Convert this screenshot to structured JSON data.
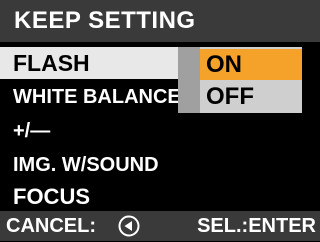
{
  "header": {
    "title": "KEEP SETTING"
  },
  "menu": {
    "items": [
      {
        "label": "FLASH",
        "selected": true
      },
      {
        "label": "WHITE BALANCE",
        "selected": false
      },
      {
        "label": "+/—",
        "selected": false
      },
      {
        "label": "IMG. W/SOUND",
        "selected": false
      },
      {
        "label": "FOCUS",
        "selected": false
      }
    ]
  },
  "submenu": {
    "items": [
      {
        "label": "ON",
        "selected": true
      },
      {
        "label": "OFF",
        "selected": false
      }
    ]
  },
  "footer": {
    "cancel_label": "CANCEL:",
    "cancel_icon": "left-arrow-icon",
    "enter_label": "SEL.:ENTER"
  },
  "colors": {
    "header_bg": "#3a3a3a",
    "selected_menu_bg": "#e8e8e8",
    "submenu_bg": "#cfcfcf",
    "submenu_selected_bg": "#f4a22a"
  }
}
